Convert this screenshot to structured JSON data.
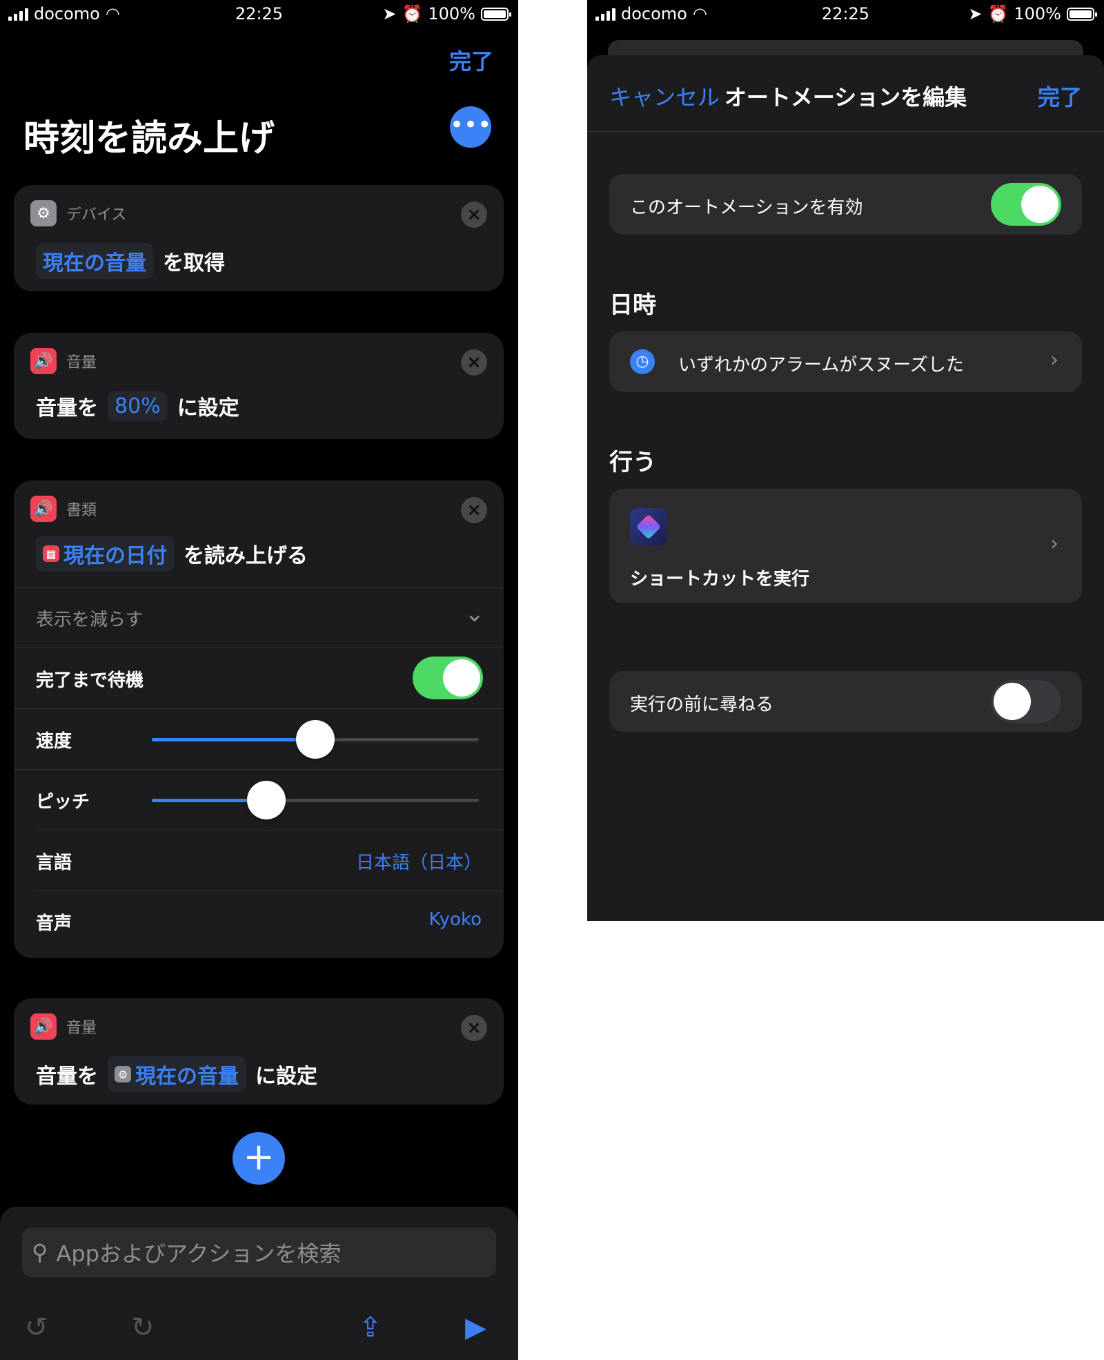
{
  "status_bar": {
    "carrier": "docomo",
    "time": "22:25",
    "battery": "100%"
  },
  "left": {
    "done_label": "完了",
    "title": "時刻を読み上げ",
    "more_icon": "ellipsis-icon",
    "actions": [
      {
        "category": "デバイス",
        "value": "現在の音量",
        "text": "を取得"
      },
      {
        "category": "音量",
        "prefix": "音量を",
        "value": "80%",
        "text": "に設定"
      },
      {
        "category": "書類",
        "value": "現在の日付",
        "text": "を読み上げる",
        "show_less": "表示を減らす",
        "options": {
          "wait_label": "完了まで待機",
          "wait_on": true,
          "speed_label": "速度",
          "speed_level": 0.5,
          "pitch_label": "ピッチ",
          "pitch_level": 0.35,
          "language_label": "言語",
          "language_value": "日本語（日本）",
          "voice_label": "音声",
          "voice_value": "Kyoko"
        }
      },
      {
        "category": "音量",
        "prefix": "音量を",
        "value": "現在の音量",
        "text": "に設定"
      }
    ],
    "search_placeholder": "Appおよびアクションを検索"
  },
  "right": {
    "cancel_label": "キャンセル",
    "title": "オートメーションを編集",
    "done_label": "完了",
    "enable_label": "このオートメーションを有効",
    "enable_on": true,
    "when_title": "日時",
    "trigger_label": "いずれかのアラームがスヌーズした",
    "do_title": "行う",
    "action_label": "ショートカットを実行",
    "ask_label": "実行の前に尋ねる",
    "ask_on": false
  },
  "colors": {
    "accent": "#3b82f6",
    "toggle_on": "#4cd964",
    "sound_icon": "#ef4456"
  }
}
